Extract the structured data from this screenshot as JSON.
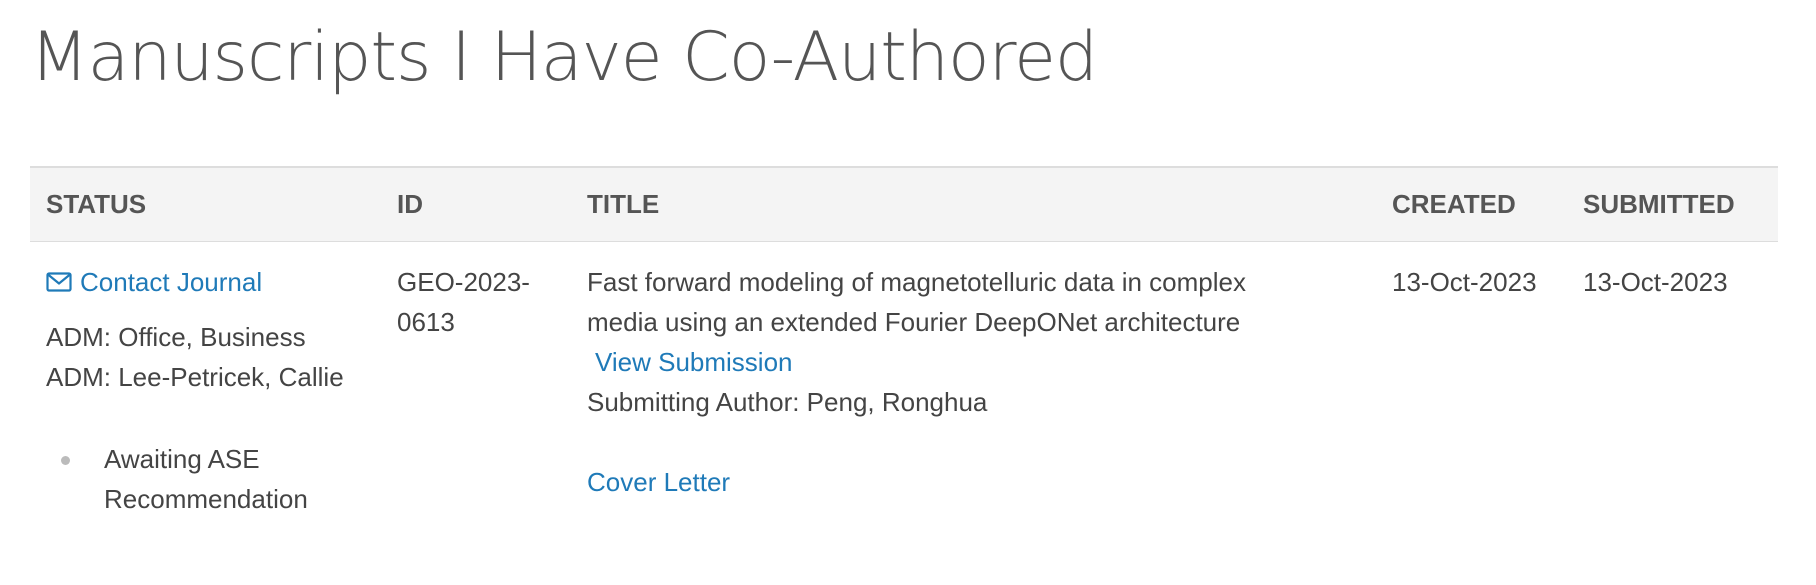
{
  "page": {
    "title": "Manuscripts I Have Co-Authored"
  },
  "table": {
    "headers": {
      "status": "STATUS",
      "id": "ID",
      "title": "TITLE",
      "created": "CREATED",
      "submitted": "SUBMITTED"
    },
    "rows": [
      {
        "contact_label": "Contact Journal",
        "admins": [
          "ADM: Office, Business",
          "ADM: Lee-Petricek, Callie"
        ],
        "status_text": "Awaiting ASE Recommendation",
        "id_line1": "GEO-2023-",
        "id_line2": "0613",
        "title_line1": "Fast forward modeling of magnetotelluric data in complex",
        "title_line2": "media using an extended Fourier DeepONet architecture",
        "view_submission_label": "View Submission",
        "submitting_author": "Submitting Author: Peng, Ronghua",
        "cover_letter_label": "Cover Letter",
        "created": "13-Oct-2023",
        "submitted": "13-Oct-2023"
      }
    ]
  },
  "icons": {
    "contact": "envelope-icon",
    "status_bullet": "bullet-icon"
  },
  "colors": {
    "link": "#1f7ab8",
    "header_bg": "#f4f4f4",
    "text": "#444444"
  }
}
